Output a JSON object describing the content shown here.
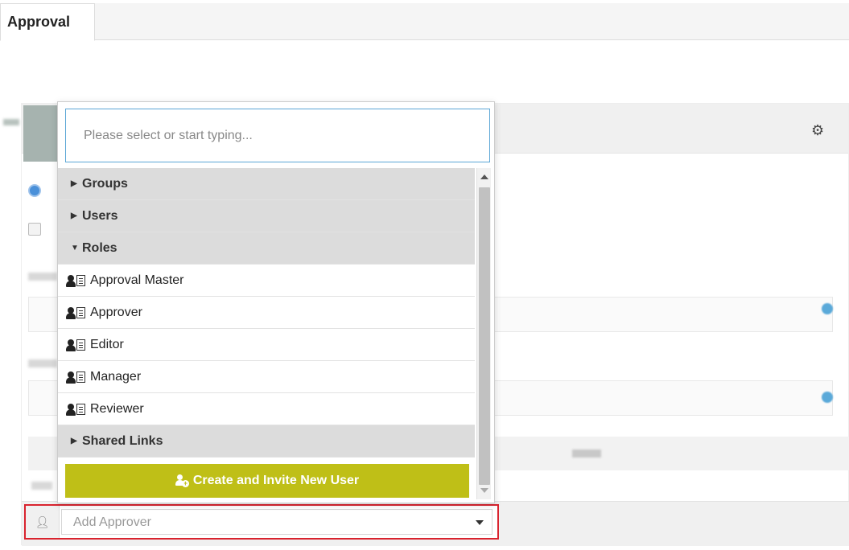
{
  "tabs": [
    {
      "label": "Approval"
    }
  ],
  "dropdown": {
    "search_placeholder": "Please select or start typing...",
    "groups": [
      {
        "label": "Groups",
        "expanded": false
      },
      {
        "label": "Users",
        "expanded": false
      },
      {
        "label": "Roles",
        "expanded": true
      },
      {
        "label": "Shared Links",
        "expanded": false
      }
    ],
    "roles": [
      {
        "label": "Approval Master"
      },
      {
        "label": "Approver"
      },
      {
        "label": "Editor"
      },
      {
        "label": "Manager"
      },
      {
        "label": "Reviewer"
      }
    ],
    "create_button_label": "Create and Invite New User"
  },
  "approver": {
    "placeholder": "Add Approver"
  },
  "colors": {
    "accent_button": "#bfbf17",
    "highlight_border": "#d9232e",
    "search_border": "#5ba6d6",
    "group_row_bg": "#dcdcdc"
  }
}
